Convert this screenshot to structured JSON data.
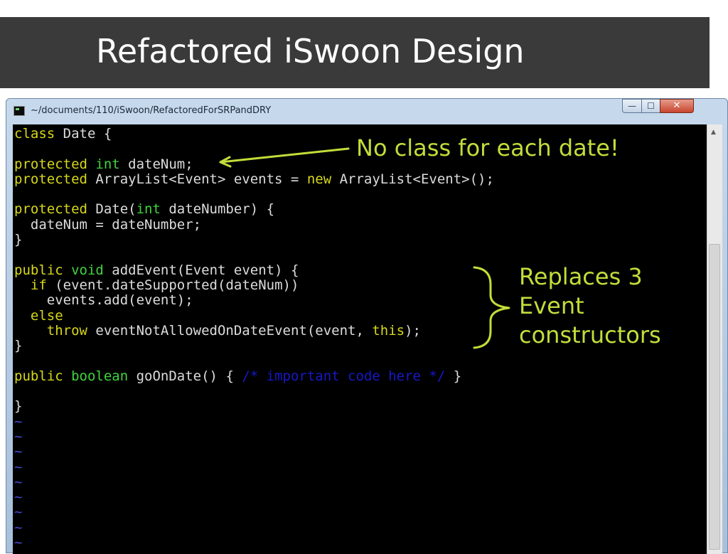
{
  "slide": {
    "title": "Refactored iSwoon Design"
  },
  "window": {
    "title": "~/documents/110/iSwoon/RefactoredForSRPandDRY",
    "icons": {
      "app": "terminal-icon",
      "minimize": "minimize-icon",
      "maximize": "maximize-icon",
      "close": "close-icon"
    },
    "glyphs": {
      "minimize": "—",
      "maximize": "☐",
      "close": "✕",
      "scroll_up": "▲"
    }
  },
  "code": {
    "l1": {
      "a": "class",
      "b": " Date {"
    },
    "l3": {
      "a": "protected",
      "b": " ",
      "c": "int",
      "d": " dateNum;"
    },
    "l4": {
      "a": "protected",
      "b": " ArrayList<Event> events = ",
      "c": "new",
      "d": " ArrayList<Event>();"
    },
    "l6": {
      "a": "protected",
      "b": " Date(",
      "c": "int",
      "d": " dateNumber) {"
    },
    "l7": "  dateNum = dateNumber;",
    "l8": "}",
    "l10": {
      "a": "public",
      "b": " ",
      "c": "void",
      "d": " addEvent(Event event) {"
    },
    "l11": {
      "a": "  ",
      "b": "if",
      "c": " (event.dateSupported(dateNum))"
    },
    "l12": "    events.add(event);",
    "l13": {
      "a": "  ",
      "b": "else"
    },
    "l14": {
      "a": "    ",
      "b": "throw",
      "c": " eventNotAllowedOnDateEvent(event, ",
      "d": "this",
      "e": ");"
    },
    "l15": "}",
    "l17": {
      "a": "public",
      "b": " ",
      "c": "boolean",
      "d": " goOnDate() { ",
      "e": "/* important code here */",
      "f": " }"
    },
    "l19": "}",
    "tilde": "~"
  },
  "annotations": {
    "no_class": "No class for each date!",
    "replaces_1": "Replaces 3",
    "replaces_2": "Event",
    "replaces_3": "constructors"
  },
  "colors": {
    "accent": "#c2dd3a",
    "keyword": "#d7d71a",
    "type_keyword": "#3fd43f",
    "comment": "#1818c8",
    "tilde": "#4a4ad8",
    "title_bar": "#3a3a3a"
  }
}
